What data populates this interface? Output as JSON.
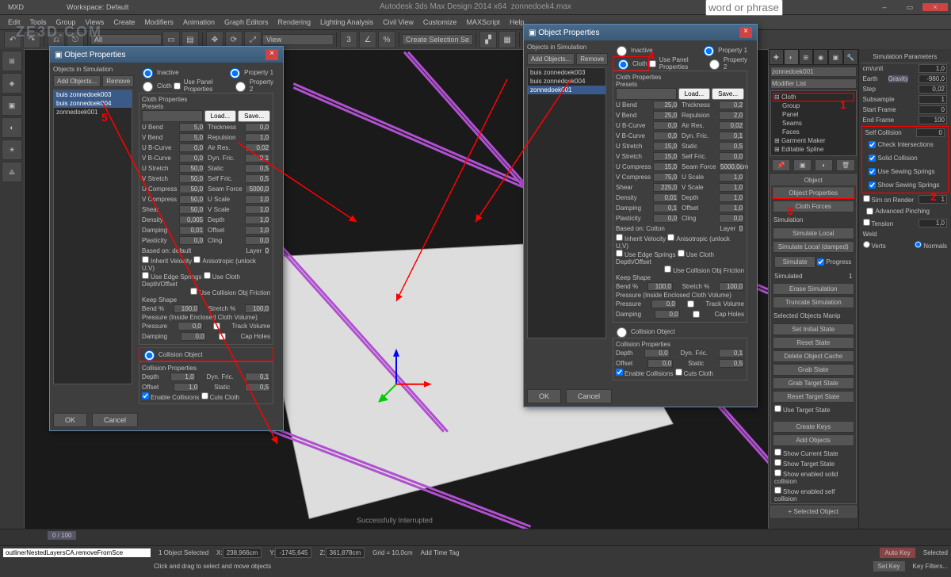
{
  "app": {
    "title": "Autodesk 3ds Max Design 2014 x64",
    "file": "zonnedoek4.max",
    "workspace": "Workspace: Default",
    "mxd": "MXD"
  },
  "menus": [
    "Edit",
    "Tools",
    "Group",
    "Views",
    "Create",
    "Modifiers",
    "Animation",
    "Graph Editors",
    "Rendering",
    "Lighting Analysis",
    "Civil View",
    "Customize",
    "MAXScript",
    "Help"
  ],
  "toolbar": {
    "drop1": "Create Selection Se",
    "search_ph": "word or phrase"
  },
  "watermark": "ZE3D.COM",
  "dialog1": {
    "title": "Object Properties",
    "sim_label": "Objects in Simulation",
    "add": "Add Objects...",
    "remove": "Remove",
    "list": [
      "buis zonnedoek003",
      "buis zonnedoek004",
      "zonnedoek001"
    ],
    "inactive": "Inactive",
    "cloth": "Cloth",
    "usepanel": "Use Panel Properties",
    "prop1": "Property 1",
    "prop2": "Property 2",
    "cloth_props": "Cloth Properties",
    "presets": "Presets",
    "load": "Load...",
    "save": "Save...",
    "params": [
      [
        "U Bend",
        "5,0",
        "Thickness",
        "0,0"
      ],
      [
        "V Bend",
        "5,0",
        "Repulsion",
        "1,0"
      ],
      [
        "U B-Curve",
        "0,0",
        "Air Res.",
        "0,02"
      ],
      [
        "V B-Curve",
        "0,0",
        "Dyn. Fric.",
        "0,1"
      ],
      [
        "U Stretch",
        "50,0",
        "Static",
        "0,5"
      ],
      [
        "V Stretch",
        "50,0",
        "Self Fric.",
        "0,5"
      ],
      [
        "U Compress",
        "50,0",
        "Seam Force",
        "5000,0"
      ],
      [
        "V Compress",
        "50,0",
        "U Scale",
        "1,0"
      ],
      [
        "Shear",
        "50,0",
        "V Scale",
        "1,0"
      ],
      [
        "Density",
        "0,005",
        "Depth",
        "1,0"
      ],
      [
        "Damping",
        "0,01",
        "Offset",
        "1,0"
      ],
      [
        "Plasticity",
        "0,0",
        "Cling",
        "0,0"
      ]
    ],
    "based_on": "Based on: default",
    "layer": "Layer",
    "layer_v": "0",
    "inherit": "Inherit Velocity",
    "aniso": "Anisotropic (unlock U,V)",
    "edge": "Use Edge Springs",
    "depth": "Use Cloth Depth/Offset",
    "coll": "Use Collision Obj Friction",
    "keepshape": "Keep Shape",
    "bend": "Bend %",
    "bend_v": "100,0",
    "stretch": "Stretch %",
    "stretch_v": "100,0",
    "pressure_grp": "Pressure (Inside Enclosed Cloth Volume)",
    "pressure": "Pressure",
    "pressure_v": "0,0",
    "damping": "Damping",
    "damping_v": "0,0",
    "track": "Track Volume",
    "cap": "Cap Holes",
    "collision": "Collision Object",
    "collprops": "Collision Properties",
    "depth2": "Depth",
    "depth2_v": "1,0",
    "offset": "Offset",
    "offset_v": "1,0",
    "dynf": "Dyn. Fric.",
    "dynf_v": "0,1",
    "statf": "Static",
    "statf_v": "0,5",
    "enable": "Enable Collisions",
    "cuts": "Cuts Cloth",
    "ok": "OK",
    "cancel": "Cancel"
  },
  "dialog2": {
    "title": "Object Properties",
    "sim_label": "Objects in Simulation",
    "add": "Add Objects...",
    "remove": "Remove",
    "list": [
      "buis zonnedoek003",
      "buis zonnedoek004",
      "zonnedoek001"
    ],
    "inactive": "Inactive",
    "cloth": "Cloth",
    "usepanel": "Use Panel Properties",
    "prop1": "Property 1",
    "prop2": "Property 2",
    "cloth_props": "Cloth Properties",
    "presets": "Presets",
    "load": "Load...",
    "save": "Save...",
    "params": [
      [
        "U Bend",
        "25,0",
        "Thickness",
        "0,2"
      ],
      [
        "V Bend",
        "25,0",
        "Repulsion",
        "2,0"
      ],
      [
        "U B-Curve",
        "0,0",
        "Air Res.",
        "0,02"
      ],
      [
        "V B-Curve",
        "0,0",
        "Dyn. Fric.",
        "0,1"
      ],
      [
        "U Stretch",
        "15,0",
        "Static",
        "0,5"
      ],
      [
        "V Stretch",
        "15,0",
        "Self Fric.",
        "0,0"
      ],
      [
        "U Compress",
        "15,0",
        "Seam Force",
        "5000,0cm"
      ],
      [
        "V Compress",
        "75,0",
        "U Scale",
        "1,0"
      ],
      [
        "Shear",
        "225,0",
        "V Scale",
        "1,0"
      ],
      [
        "Density",
        "0,01",
        "Depth",
        "1,0"
      ],
      [
        "Damping",
        "0,1",
        "Offset",
        "1,0"
      ],
      [
        "Plasticity",
        "0,0",
        "Cling",
        "0,0"
      ]
    ],
    "based_on": "Based on: Cotton",
    "layer": "Layer",
    "layer_v": "0",
    "keepshape": "Keep Shape",
    "bend": "Bend %",
    "bend_v": "100,0",
    "stretch": "Stretch %",
    "stretch_v": "100,0",
    "pressure_grp": "Pressure (Inside Enclosed Cloth Volume)",
    "pressure": "Pressure",
    "pressure_v": "0,0",
    "damping": "Damping",
    "damping_v": "0,0",
    "track": "Track Volume",
    "cap": "Cap Holes",
    "collision": "Collision Object",
    "collprops": "Collision Properties",
    "depth2": "Depth",
    "depth2_v": "0,0",
    "offset": "Offset",
    "offset_v": "0,0",
    "dynf": "Dyn. Fric.",
    "dynf_v": "0,1",
    "statf": "Static",
    "statf_v": "0,5",
    "enable": "Enable Collisions",
    "cuts": "Cuts Cloth",
    "ok": "OK",
    "cancel": "Cancel"
  },
  "cmdpanel": {
    "obj": "zonnedoek001",
    "modlist": "Modifier List",
    "stack": [
      "Cloth",
      "Group",
      "Panel",
      "Seams",
      "Faces",
      "Garment Maker",
      "Editable Spline"
    ],
    "object_head": "Object",
    "objprops": "Object Properties",
    "forces": "Cloth Forces",
    "sim_head": "Simulation",
    "simlocal": "Simulate Local",
    "simlocald": "Simulate Local (damped)",
    "simulate": "Simulate",
    "progress": "Progress",
    "simulated": "Simulated",
    "simulated_v": "1",
    "erase": "Erase Simulation",
    "trunc": "Truncate Simulation",
    "manip": "Selected Objects Manip",
    "setinit": "Set Initial State",
    "reset": "Reset State",
    "delete": "Delete Object Cache",
    "grab": "Grab State",
    "grabt": "Grab Target State",
    "resett": "Reset Target State",
    "uset": "Use Target State",
    "ckeys": "Create Keys",
    "addobj": "Add Objects",
    "showc": "Show Current State",
    "showt": "Show Target State",
    "showsolid": "Show enabled solid collision",
    "showself": "Show enabled self collision",
    "selobj": "Selected Object"
  },
  "simpanel": {
    "head": "Simulation Parameters",
    "cmunit": "cm/unit",
    "cmunit_v": "1,0",
    "earth": "Earth",
    "gravity": "Gravity",
    "gravity_v": "-980,0",
    "step": "Step",
    "step_v": "0,02",
    "subsample": "Subsample",
    "subsample_v": "1",
    "startf": "Start Frame",
    "startf_v": "0",
    "endf": "End Frame",
    "endf_v": "100",
    "selfc": "Self Collision",
    "selfc_v": "0",
    "checki": "Check Intersections",
    "solidc": "Solid Collision",
    "usesew": "Use Sewing Springs",
    "showsew": "Show Sewing Springs",
    "simr": "Sim on Render",
    "simr_v": "1",
    "adv": "Advanced Pinching",
    "tension": "Tension",
    "tension_v": "1,0",
    "weld": "Weld",
    "verts": "Verts",
    "normals": "Normals"
  },
  "status": {
    "sel": "1 Object Selected",
    "hint": "Click and drag to select and move objects",
    "x": "238,966cm",
    "y": "-1745,645",
    "z": "361,878cm",
    "grid": "Grid = 10,0cm",
    "autokey": "Auto Key",
    "setkey": "Set Key",
    "selected": "Selected",
    "keyf": "Key Filters...",
    "addtime": "Add Time Tag",
    "interrupted": "Successfully Interrupted",
    "timeline": "0 / 100",
    "script": "outlinerNestedLayersCA.removeFromSce"
  },
  "annot": {
    "a1": "1",
    "a2": "2",
    "a3": "3",
    "a4": "4",
    "a5": "5"
  }
}
